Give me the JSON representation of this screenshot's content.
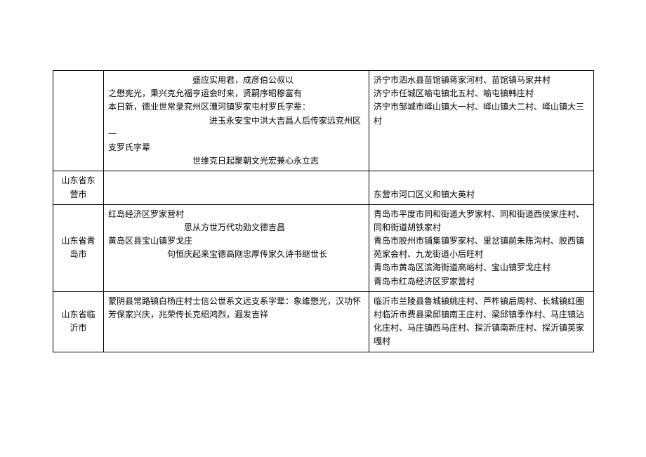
{
  "rows": [
    {
      "region": "",
      "middle_lines": [
        "　　　　　　　　　　盛应实用君，成彦伯公叔以",
        "之懋宪光，秉兴克允福亨运会时来，贤嗣序昭穆富有",
        "本日新，德业世常录兖州区漕河镇罗家屯村罗氏字辈：",
        "　　　　　　　　　　　　进玉永安宝中洪大吉昌人后传家远兖州区一",
        "支罗氏字辈",
        "　　　　　　　　　　世维克日起聚朝文光宏兼心永立志"
      ],
      "right_lines": [
        "济宁市泗水县苗馆镇蒋家河村、苗馆镇马家井村",
        "济宁市任城区喻屯镇北五村、喻屯镇韩庄村",
        "济宁市邹城市峄山镇大一村、峄山镇大二村、峄山镇大三村"
      ]
    },
    {
      "region": "山东省东营市",
      "middle_lines": [],
      "right_lines": [
        "东营市河口区义和镇大英村"
      ]
    },
    {
      "region": "山东省青岛市",
      "middle_lines": [
        "红岛经济区罗家营村",
        "　　　　　　　　　思从方世万代功勋文德吉昌",
        "黄岛区县宝山镇罗戈庄",
        "　　　　　　　句恒庆起来宝德高刚忠厚传家久诗书继世长"
      ],
      "right_lines": [
        "青岛市平度市同和街道大罗家村、同和街道西侯家庄村、同和街道胡铁家村",
        "青岛市胶州市铺集镇罗家村、里岔镇前朱陈沟村、胶西镇苑家会村、九龙街道小后旺村",
        "青岛市黄岛区滨海街道高峪村、宝山镇罗戈庄村",
        "青岛市红岛经济区罗家营村"
      ]
    },
    {
      "region": "山东省临沂市",
      "middle_lines": [
        "蒙阴县常路镇白杨庄村士信公世系文远支系字辈：象维懋光，汉功怀芳保家兴庆，兆荣传长克绍鸿烈，遐发吉祥"
      ],
      "right_lines": [
        "临沂市兰陵县鲁城镇姚庄村、芦柞镇后周村、长城镇红圈村临沂市费县梁邱镇南王庄村、梁邱镇季作村、马庄镇沾化庄村、马庄镇西马庄村、探沂镇南新庄村、探沂镇英家嘎村"
      ]
    }
  ]
}
